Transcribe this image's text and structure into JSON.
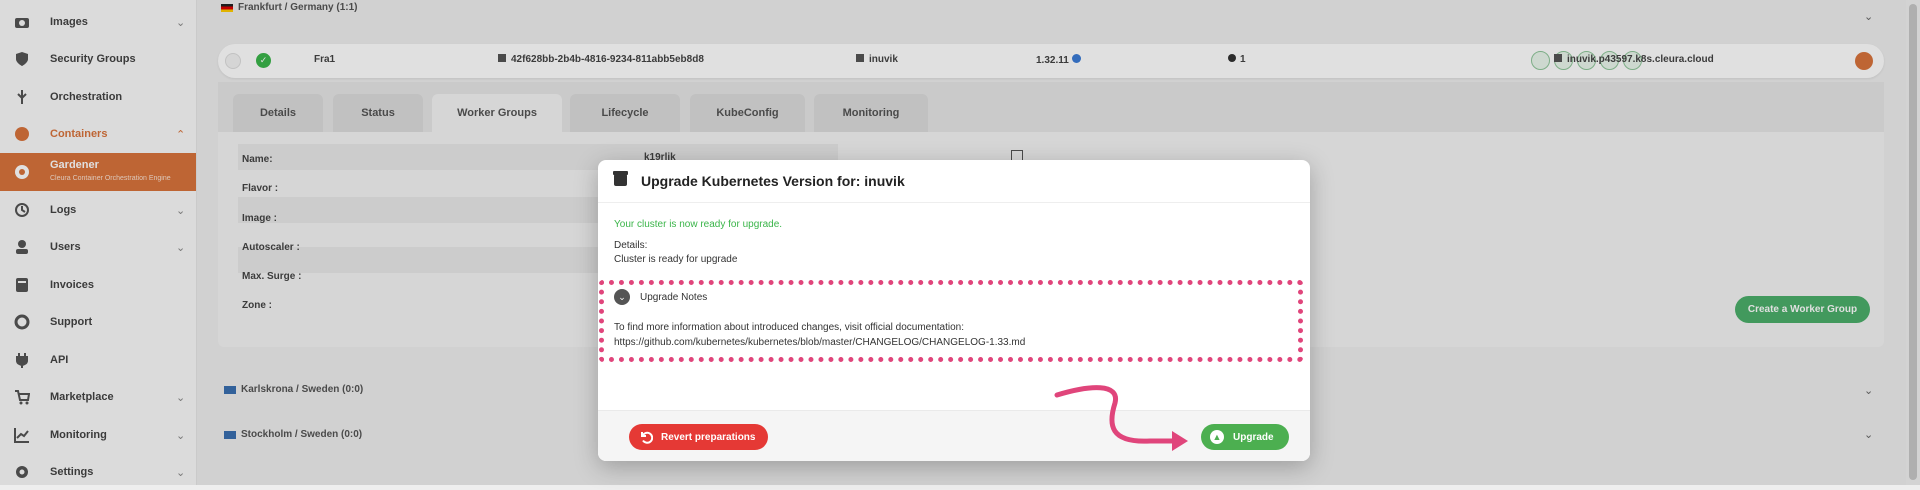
{
  "sidebar": {
    "items": [
      {
        "label": "Images",
        "icon": "camera-icon",
        "chevron": "⌄"
      },
      {
        "label": "Security Groups",
        "icon": "shield-icon",
        "chevron": ""
      },
      {
        "label": "Orchestration",
        "icon": "orchestration-icon",
        "chevron": ""
      },
      {
        "label": "Containers",
        "icon": "containers-icon",
        "chevron": "⌃"
      },
      {
        "label": "Gardener",
        "sublabel": "Cleura Container Orchestration Engine",
        "icon": "gardener-icon"
      },
      {
        "label": "Logs",
        "icon": "history-icon",
        "chevron": "⌄"
      },
      {
        "label": "Users",
        "icon": "user-icon",
        "chevron": "⌄"
      },
      {
        "label": "Invoices",
        "icon": "invoice-icon",
        "chevron": ""
      },
      {
        "label": "Support",
        "icon": "support-icon",
        "chevron": ""
      },
      {
        "label": "API",
        "icon": "plug-icon",
        "chevron": ""
      },
      {
        "label": "Marketplace",
        "icon": "cart-icon",
        "chevron": "⌄"
      },
      {
        "label": "Monitoring",
        "icon": "chart-icon",
        "chevron": "⌄"
      },
      {
        "label": "Settings",
        "icon": "gear-icon",
        "chevron": "⌄"
      }
    ]
  },
  "background": {
    "region_top": "Frankfurt / Germany (1:1)",
    "cluster": {
      "name": "Fra1",
      "id": "42f628bb-2b4b-4816-9234-811abb5eb8d8",
      "project": "inuvik",
      "version": "1.32.11",
      "count": "1",
      "domain": "inuvik.p43597.k8s.cleura.cloud"
    },
    "tabs": [
      "Details",
      "Status",
      "Worker Groups",
      "Lifecycle",
      "KubeConfig",
      "Monitoring"
    ],
    "worker_fields": [
      "Name:",
      "Flavor :",
      "Image :",
      "Autoscaler :",
      "Max. Surge :",
      "Zone :"
    ],
    "worker_name_value": "k19rlik",
    "create_worker_group": "Create a Worker Group",
    "region_2": "Karlskrona / Sweden (0:0)",
    "region_3": "Stockholm / Sweden (0:0)"
  },
  "modal": {
    "title": "Upgrade Kubernetes Version for: inuvik",
    "ready_message": "Your cluster is now ready for upgrade.",
    "details_label": "Details:",
    "details_value": "Cluster is ready for upgrade",
    "notes_title": "Upgrade Notes",
    "notes_line1": "To find more information about introduced changes, visit official documentation:",
    "notes_line2": "https://github.com/kubernetes/kubernetes/blob/master/CHANGELOG/CHANGELOG-1.33.md",
    "revert_label": "Revert preparations",
    "upgrade_label": "Upgrade"
  },
  "colors": {
    "brand": "#d9743c",
    "success": "#4caf50",
    "danger": "#e53935",
    "highlight": "#e0457b"
  }
}
